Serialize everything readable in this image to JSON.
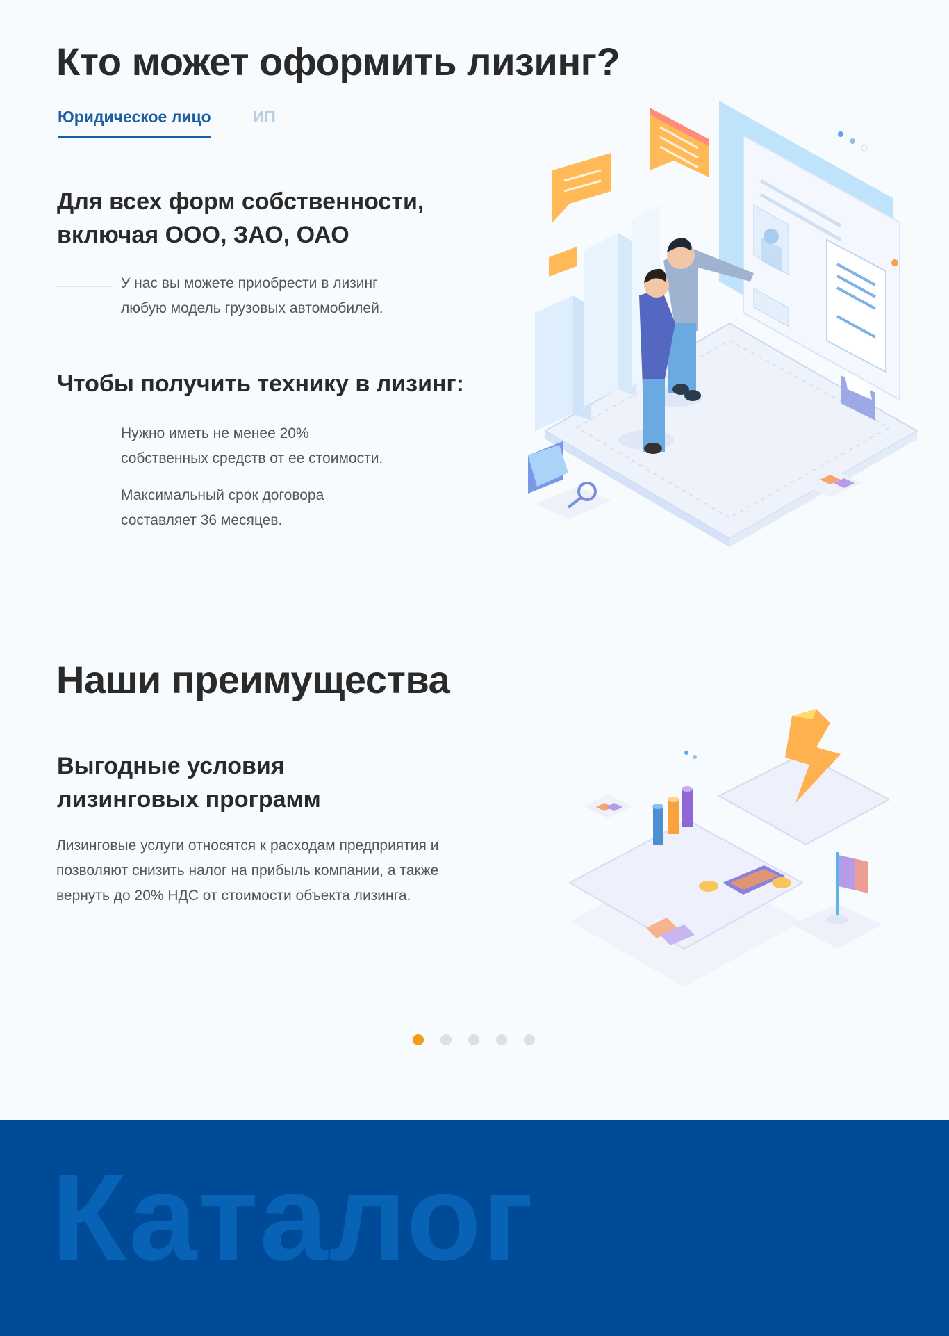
{
  "who": {
    "title": "Кто может оформить лизинг?",
    "tabs": [
      {
        "label": "Юридическое лицо",
        "active": true
      },
      {
        "label": "ИП",
        "active": false
      }
    ],
    "forms_heading_line1": "Для всех форм собственности,",
    "forms_heading_line2": "включая ООО, ЗАО, ОАО",
    "forms_text_line1": "У нас вы можете приобрести в лизинг",
    "forms_text_line2": "любую модель грузовых автомобилей.",
    "requirements_heading": "Чтобы получить технику в лизинг:",
    "req1_line1": "Нужно иметь не менее 20%",
    "req1_line2": "собственных средств от ее стоимости.",
    "req2_line1": "Максимальный срок договора",
    "req2_line2": "составляет 36 месяцев."
  },
  "advantages": {
    "title": "Наши преимущества",
    "slide_heading_line1": "Выгодные условия",
    "slide_heading_line2": "лизинговых программ",
    "slide_text_line1": "Лизинговые услуги относятся к расходам предприятия и",
    "slide_text_line2": "позволяют снизить налог на прибыль компании, а также",
    "slide_text_line3": "вернуть до 20% НДС от стоимости объекта лизинга.",
    "slides_total": 5,
    "active_slide": 1
  },
  "catalog": {
    "title": "Каталог",
    "background": "#004b97"
  },
  "colors": {
    "accent_blue": "#1c5ea3",
    "dot_active": "#f39a16",
    "dot_inactive": "#dddfe3"
  }
}
